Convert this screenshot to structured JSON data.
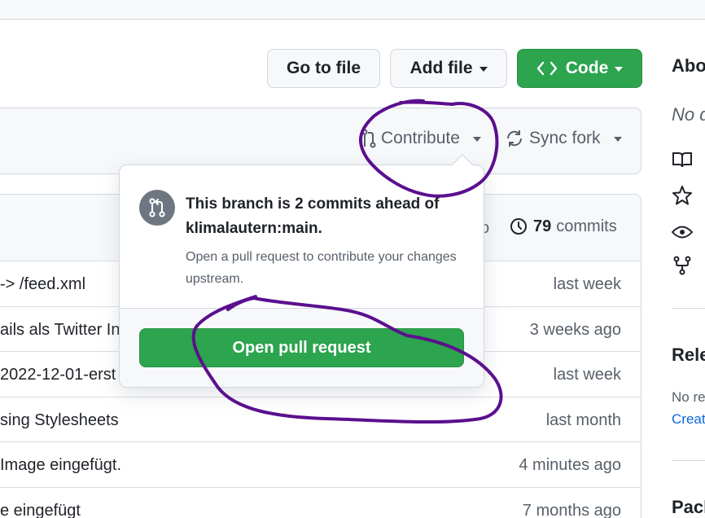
{
  "toolbar": {
    "go_to_file": "Go to file",
    "add_file": "Add file",
    "code": "Code"
  },
  "fork_bar": {
    "contribute": "Contribute",
    "sync_fork": "Sync fork"
  },
  "popover": {
    "title": "This branch is 2 commits ahead of klimalautern:main.",
    "description": "Open a pull request to contribute your changes upstream.",
    "button": "Open pull request"
  },
  "file_list": {
    "commits_count": "79",
    "commits_label": "commits",
    "header_partial": "o",
    "rows": [
      {
        "message": " -> /feed.xml",
        "time": "last week"
      },
      {
        "message": "ails als Twitter In",
        "time": "3 weeks ago"
      },
      {
        "message": "2022-12-01-erst",
        "time": "last week"
      },
      {
        "message": "sing Stylesheets",
        "time": "last month"
      },
      {
        "message": "Image eingefügt.",
        "time": "4 minutes ago"
      },
      {
        "message": "e eingefügt",
        "time": "7 months ago"
      }
    ]
  },
  "sidebar": {
    "about_heading": "Abo",
    "no_description": "No d",
    "releases_heading": "Rele",
    "no_releases": "No re",
    "create_link": "Creat",
    "packages_heading": "Pack"
  },
  "annotation": {
    "color": "#5b0f8e"
  }
}
